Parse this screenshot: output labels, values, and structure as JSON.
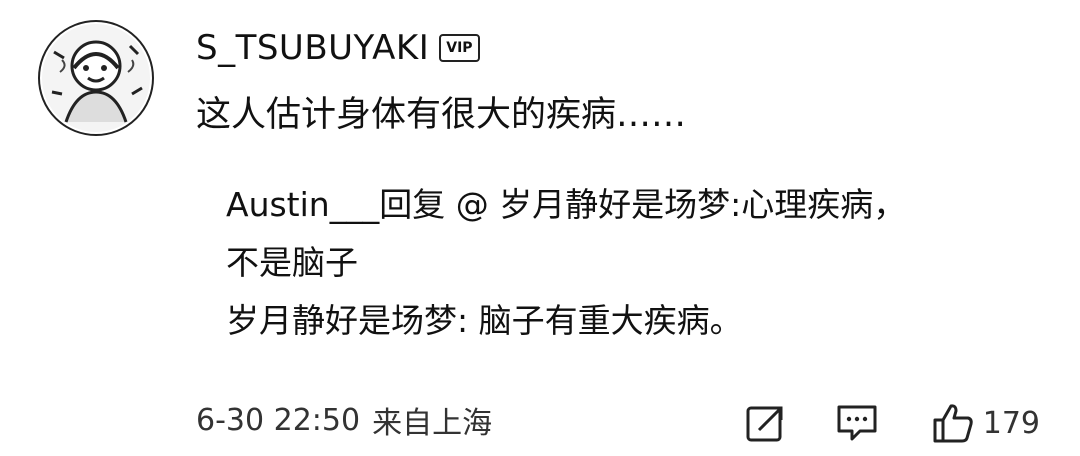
{
  "comment": {
    "username": "S_TSUBUYAKI",
    "badge": "VIP",
    "text": "这人估计身体有很大的疾病……",
    "replies": [
      {
        "line1": "Austin___回复 @ 岁月静好是场梦:心理疾病，",
        "line2": "不是脑子"
      },
      {
        "line1": "岁月静好是场梦: 脑子有重大疾病。"
      }
    ],
    "timestamp": "6-30 22:50",
    "source": "来自上海",
    "like_count": "179"
  },
  "icons": {
    "share": "share-icon",
    "reply": "comment-icon",
    "like": "thumbs-up-icon"
  }
}
